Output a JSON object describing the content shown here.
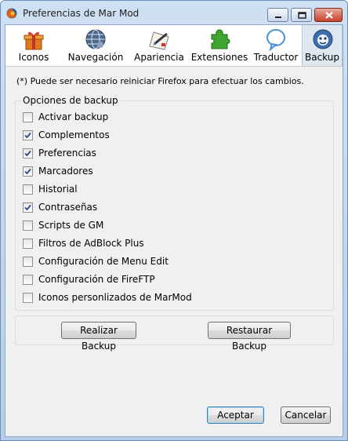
{
  "window": {
    "title": "Preferencias de Mar Mod"
  },
  "toolbar": {
    "tabs": [
      {
        "label": "Iconos",
        "icon": "gift-box-icon"
      },
      {
        "label": "Navegación",
        "icon": "globe-icon"
      },
      {
        "label": "Apariencia",
        "icon": "paint-brush-icon"
      },
      {
        "label": "Extensiones",
        "icon": "puzzle-icon"
      },
      {
        "label": "Traductor",
        "icon": "speech-bubble-icon"
      },
      {
        "label": "Backup",
        "icon": "backup-icon"
      }
    ],
    "selected": "Backup"
  },
  "notice": "(*) Puede ser necesario reiniciar Firefox para efectuar los cambios.",
  "group": {
    "label": "Opciones de backup",
    "options": [
      {
        "label": "Activar backup",
        "checked": false
      },
      {
        "label": "Complementos",
        "checked": true
      },
      {
        "label": "Preferencias",
        "checked": true
      },
      {
        "label": "Marcadores",
        "checked": true
      },
      {
        "label": "Historial",
        "checked": false
      },
      {
        "label": "Contraseñas",
        "checked": true
      },
      {
        "label": "Scripts de GM",
        "checked": false
      },
      {
        "label": "Filtros de AdBlock Plus",
        "checked": false
      },
      {
        "label": "Configuración de Menu Edit",
        "checked": false
      },
      {
        "label": "Configuración de FireFTP",
        "checked": false
      },
      {
        "label": "Iconos personlizados de MarMod",
        "checked": false
      }
    ]
  },
  "actions": {
    "backup": "Realizar Backup",
    "restore": "Restaurar Backup"
  },
  "dialog": {
    "accept": "Aceptar",
    "cancel": "Cancelar"
  }
}
